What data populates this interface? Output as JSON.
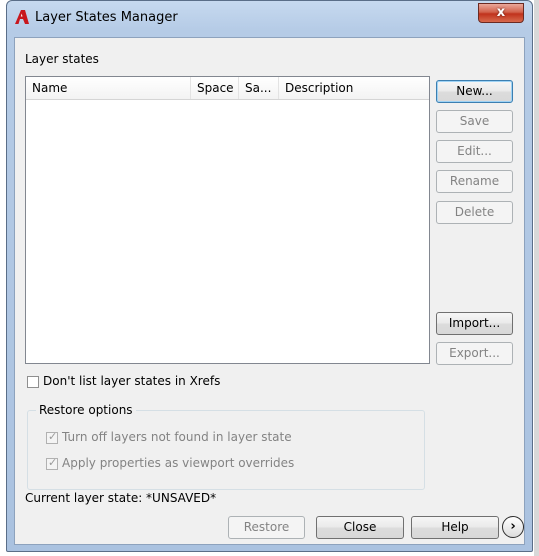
{
  "window": {
    "title": "Layer States Manager",
    "close_glyph": "x"
  },
  "layer_states": {
    "label": "Layer states",
    "columns": [
      "Name",
      "Space",
      "Sa...",
      "Description"
    ],
    "rows": []
  },
  "buttons": {
    "new": "New...",
    "save": "Save",
    "edit": "Edit...",
    "rename": "Rename",
    "delete": "Delete",
    "import": "Import...",
    "export": "Export..."
  },
  "xrefs_checkbox": {
    "label": "Don't list layer states in Xrefs",
    "checked": false
  },
  "restore_options": {
    "title": "Restore options",
    "turn_off_layers": {
      "label": "Turn off layers not found in layer state",
      "checked": true
    },
    "apply_properties": {
      "label": "Apply properties as viewport overrides",
      "checked": true
    }
  },
  "status": {
    "current_layer_state": "Current layer state: *UNSAVED*"
  },
  "footer": {
    "restore": "Restore",
    "close": "Close",
    "help": "Help",
    "expand_glyph": "›"
  },
  "colors": {
    "title_bar": "#b5cbe6",
    "close_button": "#c0321c",
    "client_bg": "#f0f0f0"
  },
  "icons": {
    "app": "autocad-app-icon",
    "expand": "chevron-right-circle-icon"
  }
}
